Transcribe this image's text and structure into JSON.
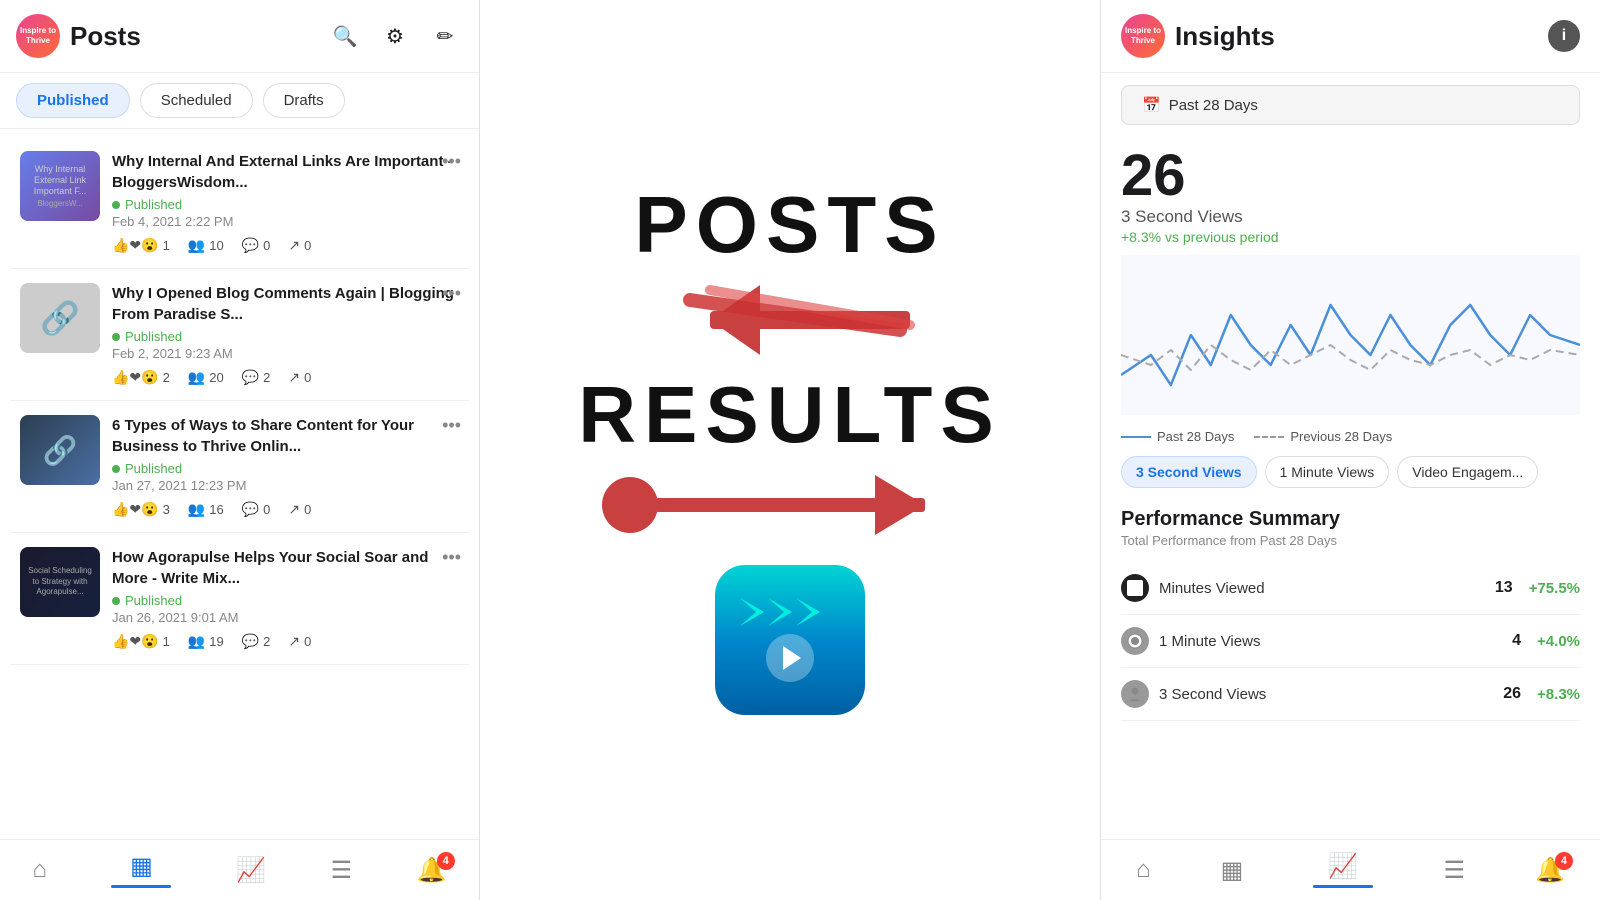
{
  "left": {
    "brand_text": "Inspire\nto\nThrive",
    "title": "Posts",
    "tabs": [
      {
        "label": "Published",
        "active": true
      },
      {
        "label": "Scheduled",
        "active": false
      },
      {
        "label": "Drafts",
        "active": false
      }
    ],
    "posts": [
      {
        "id": 1,
        "title": "Why Internal And External Links Are Important - BloggersWisdom...",
        "status": "Published",
        "date": "Feb 4, 2021 2:22 PM",
        "likes": 1,
        "reach": 10,
        "comments": 0,
        "shares": 0,
        "thumb_type": "img1"
      },
      {
        "id": 2,
        "title": "Why I Opened Blog Comments Again | Blogging From Paradise S...",
        "status": "Published",
        "date": "Feb 2, 2021 9:23 AM",
        "likes": 2,
        "reach": 20,
        "comments": 2,
        "shares": 0,
        "thumb_type": "img2"
      },
      {
        "id": 3,
        "title": "6 Types of Ways to Share Content for Your Business to Thrive Onlin...",
        "status": "Published",
        "date": "Jan 27, 2021 12:23 PM",
        "likes": 3,
        "reach": 16,
        "comments": 0,
        "shares": 0,
        "thumb_type": "img3"
      },
      {
        "id": 4,
        "title": "How Agorapulse Helps Your Social Soar and More - Write Mix...",
        "status": "Published",
        "date": "Jan 26, 2021 9:01 AM",
        "likes": 1,
        "reach": 19,
        "comments": 2,
        "shares": 0,
        "thumb_type": "img4"
      }
    ],
    "nav": {
      "home_label": "Home",
      "posts_label": "Posts",
      "analytics_label": "Analytics",
      "inbox_label": "Inbox",
      "notifications_label": "Notifications",
      "badge_count": "4"
    }
  },
  "middle": {
    "text1": "POSTS",
    "text2": "RESULTS"
  },
  "right": {
    "title": "Insights",
    "date_filter": "Past 28 Days",
    "main_number": "26",
    "main_label": "3 Second Views",
    "main_change": "+8.3% vs previous period",
    "chart_legend": {
      "past_label": "Past 28 Days",
      "previous_label": "Previous 28 Days"
    },
    "metric_tabs": [
      {
        "label": "3 Second Views",
        "active": true
      },
      {
        "label": "1 Minute Views",
        "active": false
      },
      {
        "label": "Video Engagem...",
        "active": false
      }
    ],
    "performance_title": "Performance Summary",
    "performance_subtitle": "Total Performance from Past 28 Days",
    "performance_rows": [
      {
        "label": "Minutes Viewed",
        "value": "13",
        "change": "+75.5%",
        "icon": "⬛"
      },
      {
        "label": "1 Minute Views",
        "value": "4",
        "change": "+4.0%",
        "icon": "⚙"
      },
      {
        "label": "3 Second Views",
        "value": "26",
        "change": "+8.3%",
        "icon": "👤"
      }
    ],
    "nav": {
      "home_label": "Home",
      "posts_label": "Posts",
      "analytics_label": "Analytics",
      "inbox_label": "Inbox",
      "notifications_label": "Notifications",
      "badge_count": "4"
    }
  }
}
